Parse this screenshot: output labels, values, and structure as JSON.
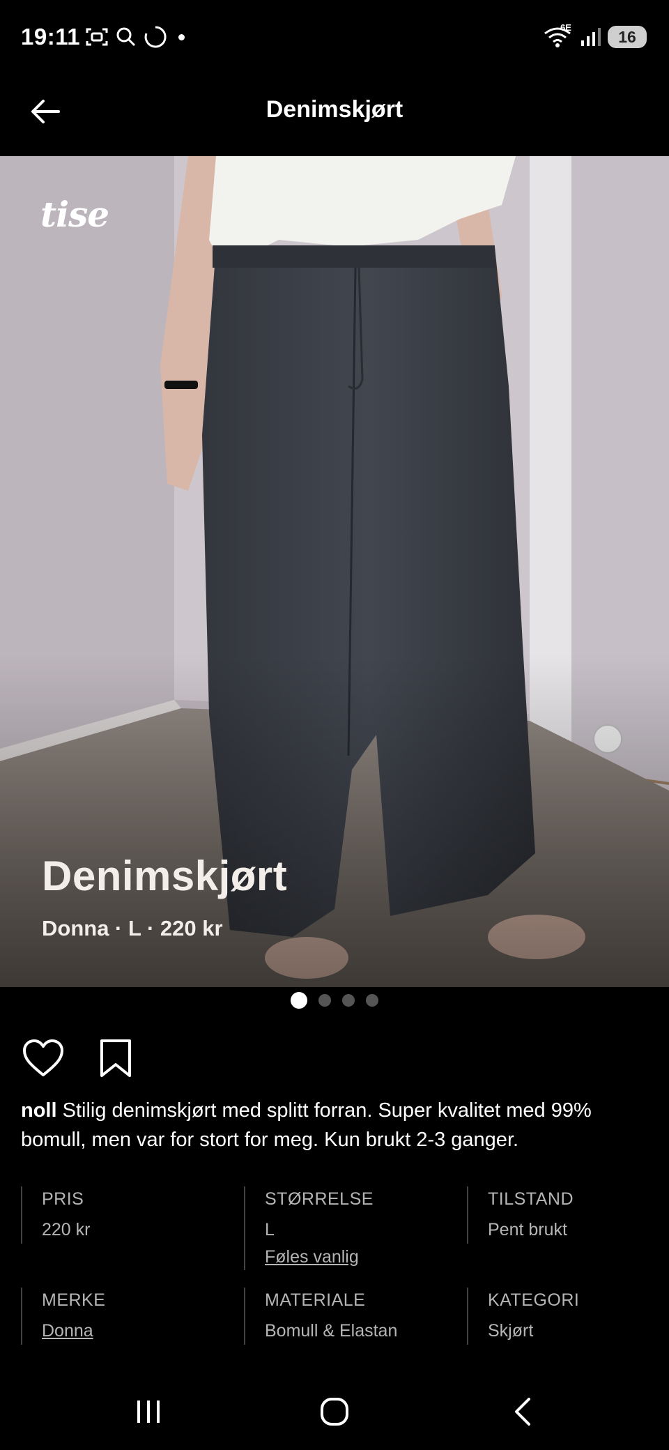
{
  "status_bar": {
    "time": "19:11",
    "network_label": "6E",
    "battery": "16"
  },
  "header": {
    "title": "Denimskjørt"
  },
  "hero": {
    "logo": "tise",
    "title": "Denimskjørt",
    "subtitle": "Donna · L · 220 kr",
    "image_count": 4,
    "active_image": 1
  },
  "description": {
    "username": "noll",
    "text": "Stilig denimskjørt med splitt forran. Super kvalitet med 99% bomull, men var for stort for meg. Kun brukt 2-3 ganger."
  },
  "details": [
    {
      "label": "PRIS",
      "value": "220 kr"
    },
    {
      "label": "STØRRELSE",
      "value": "L",
      "extra": "Føles vanlig"
    },
    {
      "label": "TILSTAND",
      "value": "Pent brukt"
    },
    {
      "label": "MERKE",
      "value": "Donna"
    },
    {
      "label": "MATERIALE",
      "value": "Bomull & Elastan"
    },
    {
      "label": "KATEGORI",
      "value": "Skjørt"
    }
  ],
  "colors": {
    "background": "#000000",
    "text": "#ffffff",
    "muted_text": "#b5b5b5",
    "skirt": "#3a3e46"
  }
}
